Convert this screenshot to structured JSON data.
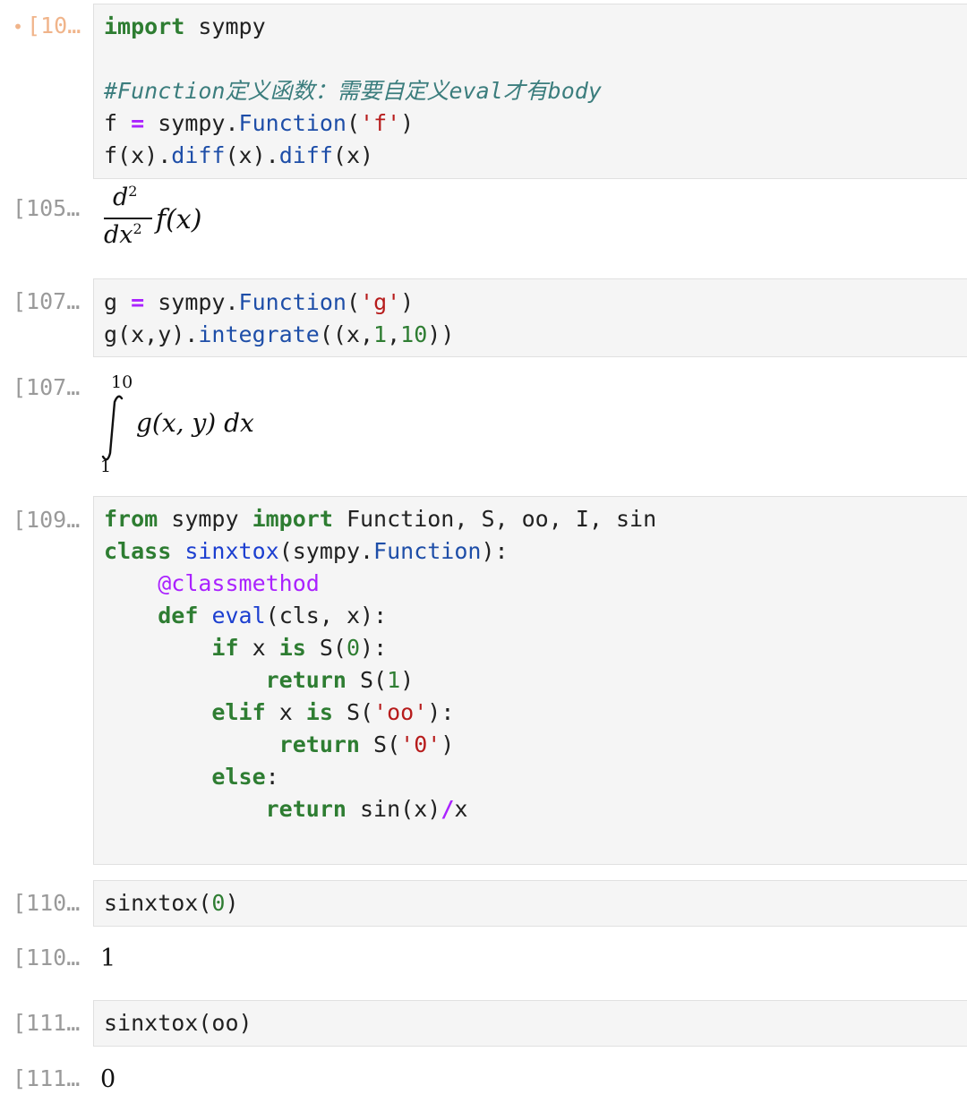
{
  "cells": [
    {
      "prompt": "[10…",
      "active": true
    },
    {
      "prompt": "[105…"
    },
    {
      "prompt": "[107…"
    },
    {
      "prompt": "[107…"
    },
    {
      "prompt": "[109…"
    },
    {
      "prompt": "[110…"
    },
    {
      "prompt": "[110…",
      "output": "1"
    },
    {
      "prompt": "[111…"
    },
    {
      "prompt": "[111…",
      "output": "0"
    }
  ],
  "math": {
    "deriv_num": "d",
    "deriv_num_exp": "2",
    "deriv_den": "dx",
    "deriv_den_exp": "2",
    "deriv_func": "f(x)",
    "int_upper": "10",
    "int_lower": "1",
    "int_body": "g(x, y) dx"
  },
  "code_cells": [
    [
      "import sympy",
      "",
      "#Function定义函数：需要自定义eval才有body",
      "f = sympy.Function('f')",
      "f(x).diff(x).diff(x)"
    ],
    [
      "g = sympy.Function('g')",
      "g(x,y).integrate((x,1,10))"
    ],
    [
      "from sympy import Function, S, oo, I, sin",
      "class sinxtox(sympy.Function):",
      "    @classmethod",
      "    def eval(cls, x):",
      "        if x is S(0):",
      "            return S(1)",
      "        elif x is S('oo'):",
      "             return S('0')",
      "        else:",
      "            return sin(x)/x"
    ],
    [
      "sinxtox(0)"
    ],
    [
      "sinxtox(oo)"
    ]
  ]
}
